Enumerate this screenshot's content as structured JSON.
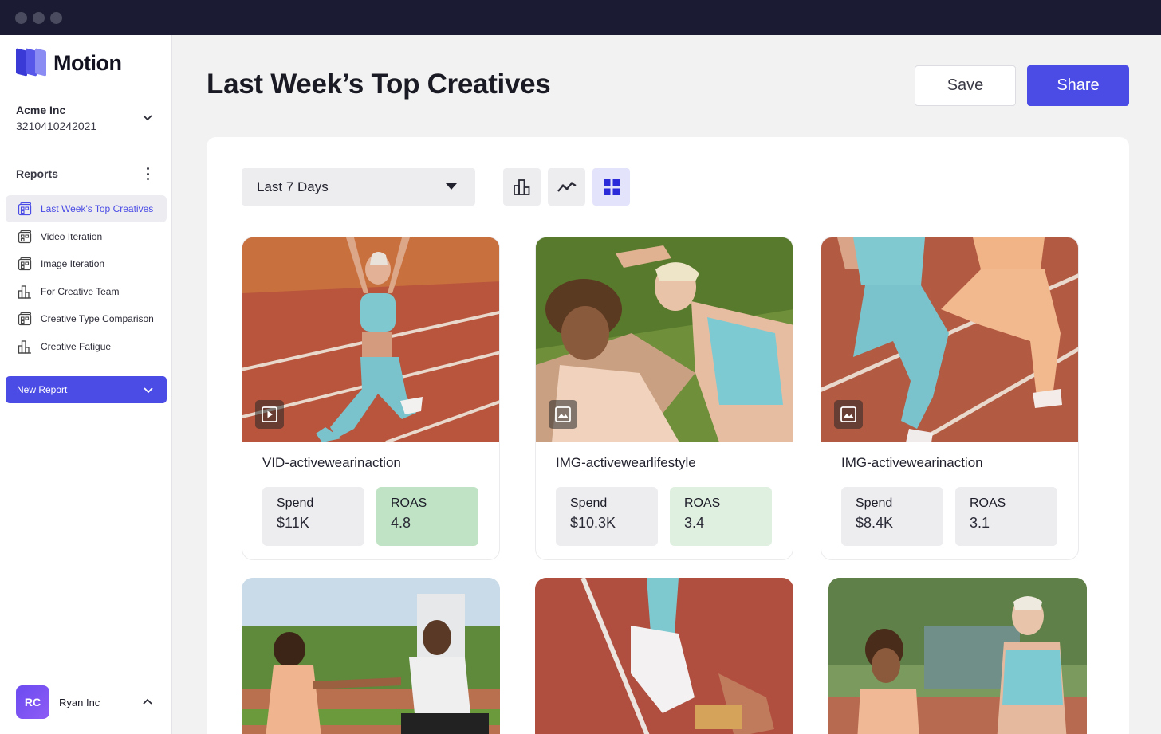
{
  "brand": {
    "name": "Motion",
    "colors": [
      "#3a3ad6",
      "#5757ea",
      "#8b8bf4"
    ]
  },
  "account": {
    "name": "Acme Inc",
    "id": "3210410242021"
  },
  "reports_section": {
    "title": "Reports"
  },
  "nav_items": [
    {
      "label": "Last Week's Top Creatives",
      "icon": "grid-report-icon",
      "active": true
    },
    {
      "label": "Video Iteration",
      "icon": "grid-report-icon",
      "active": false
    },
    {
      "label": "Image Iteration",
      "icon": "grid-report-icon",
      "active": false
    },
    {
      "label": "For Creative Team",
      "icon": "bar-chart-icon",
      "active": false
    },
    {
      "label": "Creative Type Comparison",
      "icon": "grid-report-icon",
      "active": false
    },
    {
      "label": "Creative Fatigue",
      "icon": "bar-chart-icon",
      "active": false
    }
  ],
  "new_report": {
    "label": "New Report"
  },
  "user": {
    "initials": "RC",
    "name": "Ryan Inc"
  },
  "header": {
    "title": "Last Week’s Top Creatives",
    "save_label": "Save",
    "share_label": "Share"
  },
  "toolbar": {
    "date_range": "Last 7 Days",
    "views": [
      "bar-chart-icon",
      "line-chart-icon",
      "grid-view-icon"
    ],
    "active_view": "grid-view-icon"
  },
  "cards": [
    {
      "name": "VID-activewearinaction",
      "type": "video",
      "spend_label": "Spend",
      "spend": "$11K",
      "roas_label": "ROAS",
      "roas": "4.8",
      "roas_color": "#bfe3c4"
    },
    {
      "name": "IMG-activewearlifestyle",
      "type": "image",
      "spend_label": "Spend",
      "spend": "$10.3K",
      "roas_label": "ROAS",
      "roas": "3.4",
      "roas_color": "#dff0e0"
    },
    {
      "name": "IMG-activewearinaction",
      "type": "image",
      "spend_label": "Spend",
      "spend": "$8.4K",
      "roas_label": "ROAS",
      "roas": "3.1",
      "roas_color": "#ededf0"
    }
  ],
  "colors": {
    "accent": "#4b4be6",
    "titlebar": "#1b1c33",
    "background": "#f2f2f2"
  }
}
